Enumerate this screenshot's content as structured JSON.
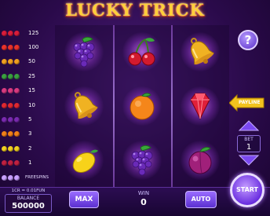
{
  "game": {
    "title": "LUCKY TRICK"
  },
  "paytable": [
    {
      "colors": [
        "#d81c3a",
        "#d81c3a",
        "#d81c3a"
      ],
      "payout": "125"
    },
    {
      "colors": [
        "#e8322a",
        "#e8322a",
        "#e8322a"
      ],
      "payout": "100"
    },
    {
      "colors": [
        "#f0a020",
        "#f0a020",
        "#f0a020"
      ],
      "payout": "50"
    },
    {
      "colors": [
        "#3aa040",
        "#3aa040",
        "#3aa040"
      ],
      "payout": "25"
    },
    {
      "colors": [
        "#d83a80",
        "#d83a80",
        "#d83a80"
      ],
      "payout": "15"
    },
    {
      "colors": [
        "#e02830",
        "#e02830",
        "#e02830"
      ],
      "payout": "10"
    },
    {
      "colors": [
        "#7a2ab0",
        "#7a2ab0",
        "#7a2ab0"
      ],
      "payout": "5"
    },
    {
      "colors": [
        "#f08018",
        "#f08018",
        "#f08018"
      ],
      "payout": "3"
    },
    {
      "colors": [
        "#f0d020",
        "#f0d020",
        "#f0d020"
      ],
      "payout": "2"
    },
    {
      "colors": [
        "#c02040",
        "#c02040",
        "#c02040"
      ],
      "payout": "1"
    },
    {
      "colors": [
        "#c8a0ff",
        "#c8a0ff",
        "#c8a0ff"
      ],
      "payout": "FREESPINS"
    }
  ],
  "reels": [
    [
      "grapes",
      "cherries",
      "bell"
    ],
    [
      "bell",
      "orange",
      "diamond"
    ],
    [
      "lemon",
      "grapes",
      "plum"
    ]
  ],
  "controls": {
    "help_label": "?",
    "payline_label": "PAYLINE",
    "bet_label": "BET",
    "bet_value": "1",
    "rate_label": "1CR = 0.01FUN",
    "balance_label": "BALANCE",
    "balance_value": "500000",
    "max_label": "MAX",
    "win_label": "WIN",
    "win_value": "0",
    "auto_label": "AUTO",
    "start_label": "START"
  },
  "colors": {
    "accent": "#7a48f0",
    "title": "#ffcf3a"
  }
}
